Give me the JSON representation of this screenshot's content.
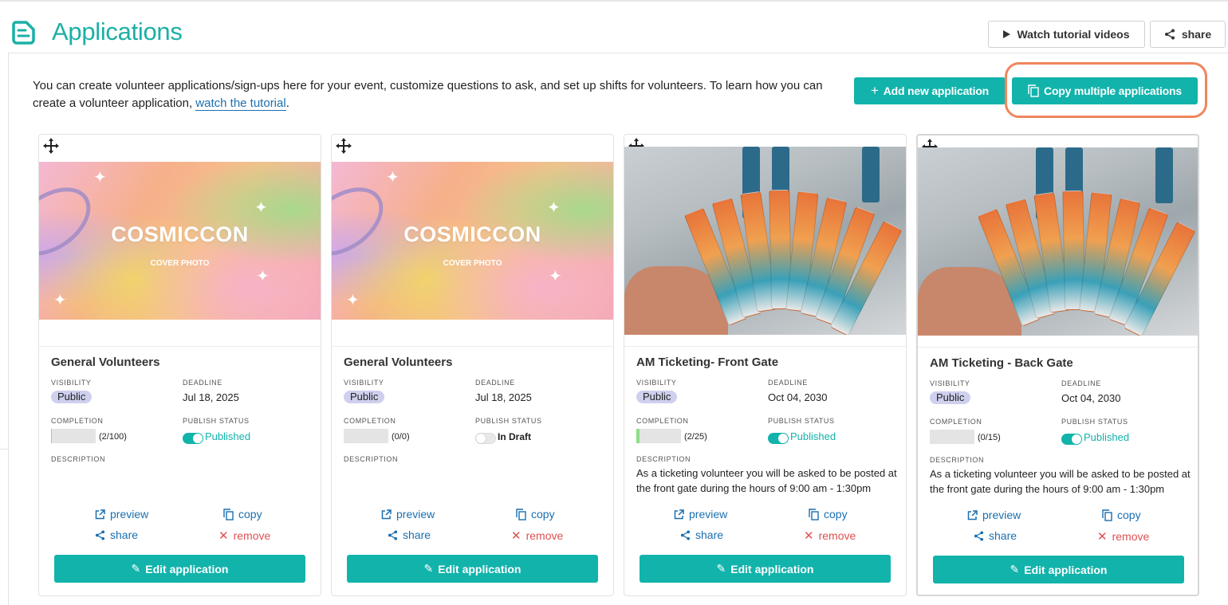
{
  "header": {
    "title": "Applications",
    "tutorial_label": "Watch tutorial videos",
    "share_label": "share"
  },
  "intro": {
    "text": "You can create volunteer applications/sign-ups here for your event, customize questions to ask, and set up shifts for volunteers. To learn how you can create a volunteer application, ",
    "link": "watch the tutorial",
    "tail": "."
  },
  "actions": {
    "add_label": "Add new application",
    "copy_multi_label": "Copy multiple applications"
  },
  "labels": {
    "visibility": "VISIBILITY",
    "deadline": "DEADLINE",
    "completion": "COMPLETION",
    "publish_status": "PUBLISH STATUS",
    "description": "DESCRIPTION",
    "preview": "preview",
    "copy": "copy",
    "share": "share",
    "remove": "remove",
    "edit": "Edit application"
  },
  "colors": {
    "accent": "#12b3ab",
    "link": "#1a6fb0",
    "remove": "#e05050",
    "highlight": "#f0855c"
  },
  "cards": [
    {
      "title": "General Volunteers",
      "visibility": "Public",
      "deadline": "Jul 18, 2025",
      "completion": "(2/100)",
      "completion_fraction": 0.02,
      "publish_status": "Published",
      "published": true,
      "description": "",
      "cover": {
        "type": "cosmic",
        "brand": "COSMICCON",
        "sub": "COVER PHOTO"
      }
    },
    {
      "title": "General Volunteers",
      "visibility": "Public",
      "deadline": "Jul 18, 2025",
      "completion": "(0/0)",
      "completion_fraction": 0,
      "publish_status": "In Draft",
      "published": false,
      "description": "",
      "cover": {
        "type": "cosmic",
        "brand": "COSMICCON",
        "sub": "COVER PHOTO"
      }
    },
    {
      "title": "AM Ticketing- Front Gate",
      "visibility": "Public",
      "deadline": "Oct 04, 2030",
      "completion": "(2/25)",
      "completion_fraction": 0.08,
      "publish_status": "Published",
      "published": true,
      "description": "As a ticketing  volunteer you will be asked to be posted at the front gate during the hours of 9:00 am - 1:30pm",
      "cover": {
        "type": "photo"
      }
    },
    {
      "title": "AM Ticketing - Back Gate",
      "visibility": "Public",
      "deadline": "Oct 04, 2030",
      "completion": "(0/15)",
      "completion_fraction": 0,
      "publish_status": "Published",
      "published": true,
      "description": "As a ticketing  volunteer you will be asked to be posted at the front gate during the hours of 9:00 am - 1:30pm",
      "cover": {
        "type": "photo"
      }
    }
  ]
}
